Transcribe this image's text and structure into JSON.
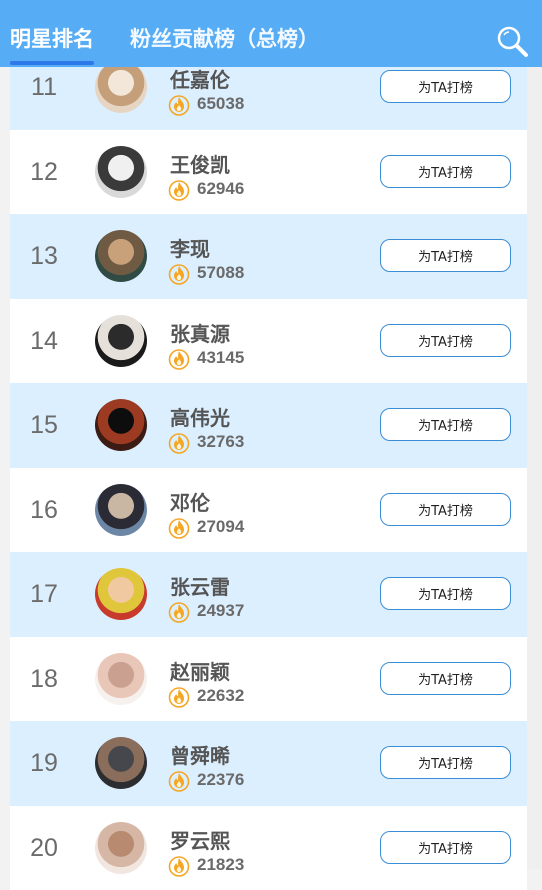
{
  "header": {
    "tab_star_ranking": "明星排名",
    "tab_fan_contribution": "粉丝贡献榜（总榜）",
    "icons": {
      "search": "search-icon",
      "flame": "flame-icon"
    }
  },
  "colors": {
    "header_bg": "#56adf5",
    "alt_row_bg": "#dcefff",
    "button_border": "#3b8ed6",
    "flame": "#f5a623"
  },
  "rows": [
    {
      "rank": "11",
      "name": "任嘉伦",
      "score": "65038",
      "button": "为TA打榜"
    },
    {
      "rank": "12",
      "name": "王俊凯",
      "score": "62946",
      "button": "为TA打榜"
    },
    {
      "rank": "13",
      "name": "李现",
      "score": "57088",
      "button": "为TA打榜"
    },
    {
      "rank": "14",
      "name": "张真源",
      "score": "43145",
      "button": "为TA打榜"
    },
    {
      "rank": "15",
      "name": "高伟光",
      "score": "32763",
      "button": "为TA打榜"
    },
    {
      "rank": "16",
      "name": "邓伦",
      "score": "27094",
      "button": "为TA打榜"
    },
    {
      "rank": "17",
      "name": "张云雷",
      "score": "24937",
      "button": "为TA打榜"
    },
    {
      "rank": "18",
      "name": "赵丽颖",
      "score": "22632",
      "button": "为TA打榜"
    },
    {
      "rank": "19",
      "name": "曾舜晞",
      "score": "22376",
      "button": "为TA打榜"
    },
    {
      "rank": "20",
      "name": "罗云熙",
      "score": "21823",
      "button": "为TA打榜"
    }
  ]
}
